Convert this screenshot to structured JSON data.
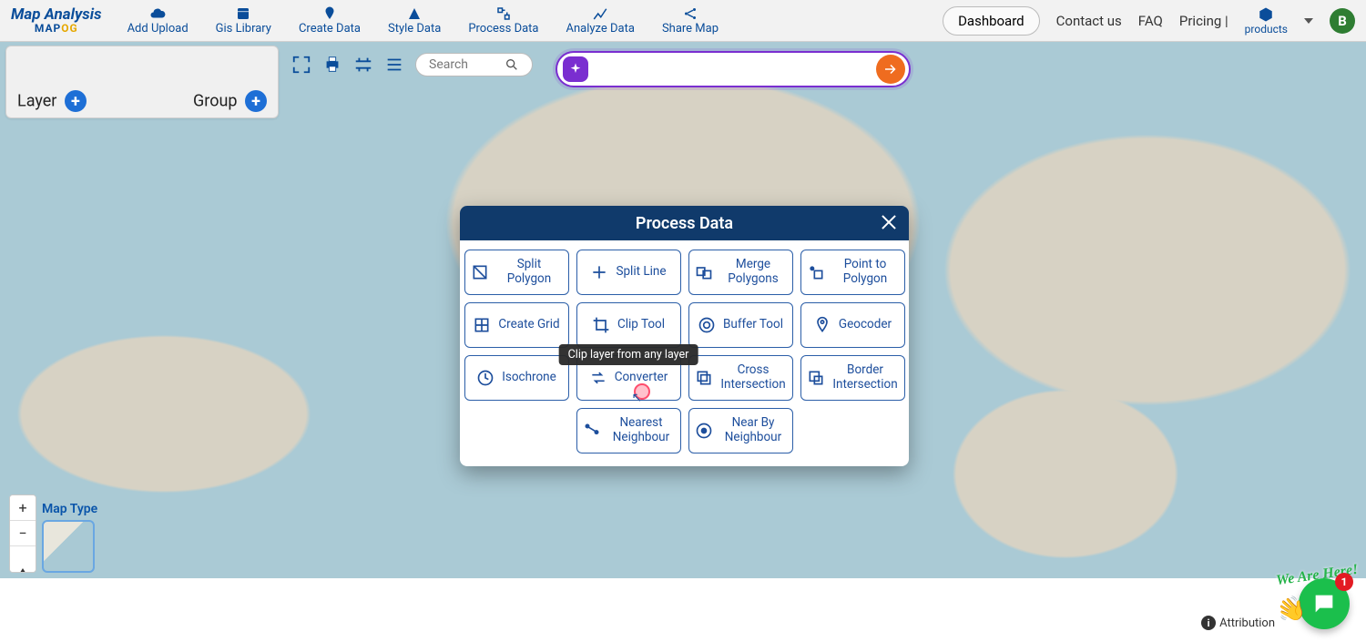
{
  "brand": {
    "title": "Map Analysis",
    "subA": "MAP",
    "subB": "OG"
  },
  "nav": [
    {
      "label": "Add Upload"
    },
    {
      "label": "Gis Library"
    },
    {
      "label": "Create Data"
    },
    {
      "label": "Style Data"
    },
    {
      "label": "Process Data"
    },
    {
      "label": "Analyze Data"
    },
    {
      "label": "Share Map"
    }
  ],
  "topRight": {
    "dashboard": "Dashboard",
    "contact": "Contact us",
    "faq": "FAQ",
    "pricing": "Pricing |",
    "products": "products",
    "avatar": "B"
  },
  "layerPanel": {
    "layer": "Layer",
    "group": "Group"
  },
  "search": {
    "placeholder": "Search"
  },
  "mapType": {
    "label": "Map Type"
  },
  "attribution": {
    "label": "Attribution"
  },
  "chat": {
    "weAreHere": "We Are Here!",
    "notif": "1"
  },
  "modal": {
    "title": "Process Data",
    "tooltip": "Clip layer from any layer",
    "tools": [
      "Split Polygon",
      "Split Line",
      "Merge Polygons",
      "Point to Polygon",
      "Create Grid",
      "Clip Tool",
      "Buffer Tool",
      "Geocoder",
      "Isochrone",
      "Converter",
      "Cross Intersection",
      "Border Intersection",
      "Nearest Neighbour",
      "Near By Neighbour"
    ]
  }
}
